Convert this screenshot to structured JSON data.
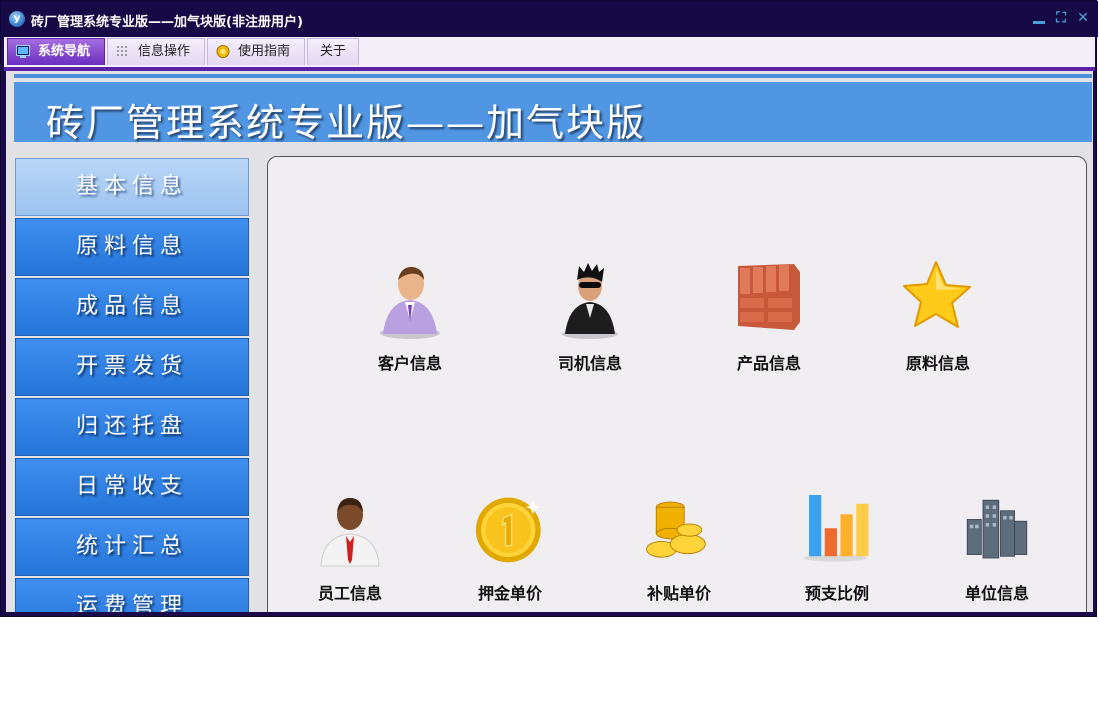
{
  "window": {
    "title": "砖厂管理系统专业版——加气块版(非注册用户)",
    "app_icon": "app-logo-icon"
  },
  "window_controls": {
    "minimize_icon": "minimize-icon",
    "restore_icon": "restore-icon",
    "close_icon": "close-icon",
    "restore_glyph": "⛶",
    "close_glyph": "✕"
  },
  "menu": {
    "tabs": [
      {
        "label": "系统导航",
        "icon": "monitor-icon",
        "active": true
      },
      {
        "label": "信息操作",
        "icon": "grid-icon",
        "active": false
      },
      {
        "label": "使用指南",
        "icon": "help-circle-icon",
        "active": false
      },
      {
        "label": "关于",
        "icon": "",
        "active": false
      }
    ]
  },
  "banner": {
    "title": "砖厂管理系统专业版——加气块版"
  },
  "sidebar": {
    "items": [
      {
        "label": "基本信息",
        "active": true
      },
      {
        "label": "原料信息",
        "active": false
      },
      {
        "label": "成品信息",
        "active": false
      },
      {
        "label": "开票发货",
        "active": false
      },
      {
        "label": "归还托盘",
        "active": false
      },
      {
        "label": "日常收支",
        "active": false
      },
      {
        "label": "统计汇总",
        "active": false
      },
      {
        "label": "运费管理",
        "active": false
      }
    ]
  },
  "tiles": {
    "row1": [
      {
        "label": "客户信息",
        "icon": "customer-person-icon"
      },
      {
        "label": "司机信息",
        "icon": "driver-person-icon"
      },
      {
        "label": "产品信息",
        "icon": "bricks-icon"
      },
      {
        "label": "原料信息",
        "icon": "star-icon"
      }
    ],
    "row2": [
      {
        "label": "员工信息",
        "icon": "employee-person-icon"
      },
      {
        "label": "押金单价",
        "icon": "gold-coin-icon"
      },
      {
        "label": "补贴单价",
        "icon": "coin-stack-icon"
      },
      {
        "label": "预支比例",
        "icon": "bar-chart-icon"
      },
      {
        "label": "单位信息",
        "icon": "buildings-icon"
      }
    ]
  },
  "colors": {
    "title_bar": "#170846",
    "menu_accent": "#5a22a8",
    "banner": "#5096e3",
    "sidebar_item": "#2f80e6",
    "sidebar_active": "#a9cbf3",
    "panel": "#f0eef0"
  }
}
